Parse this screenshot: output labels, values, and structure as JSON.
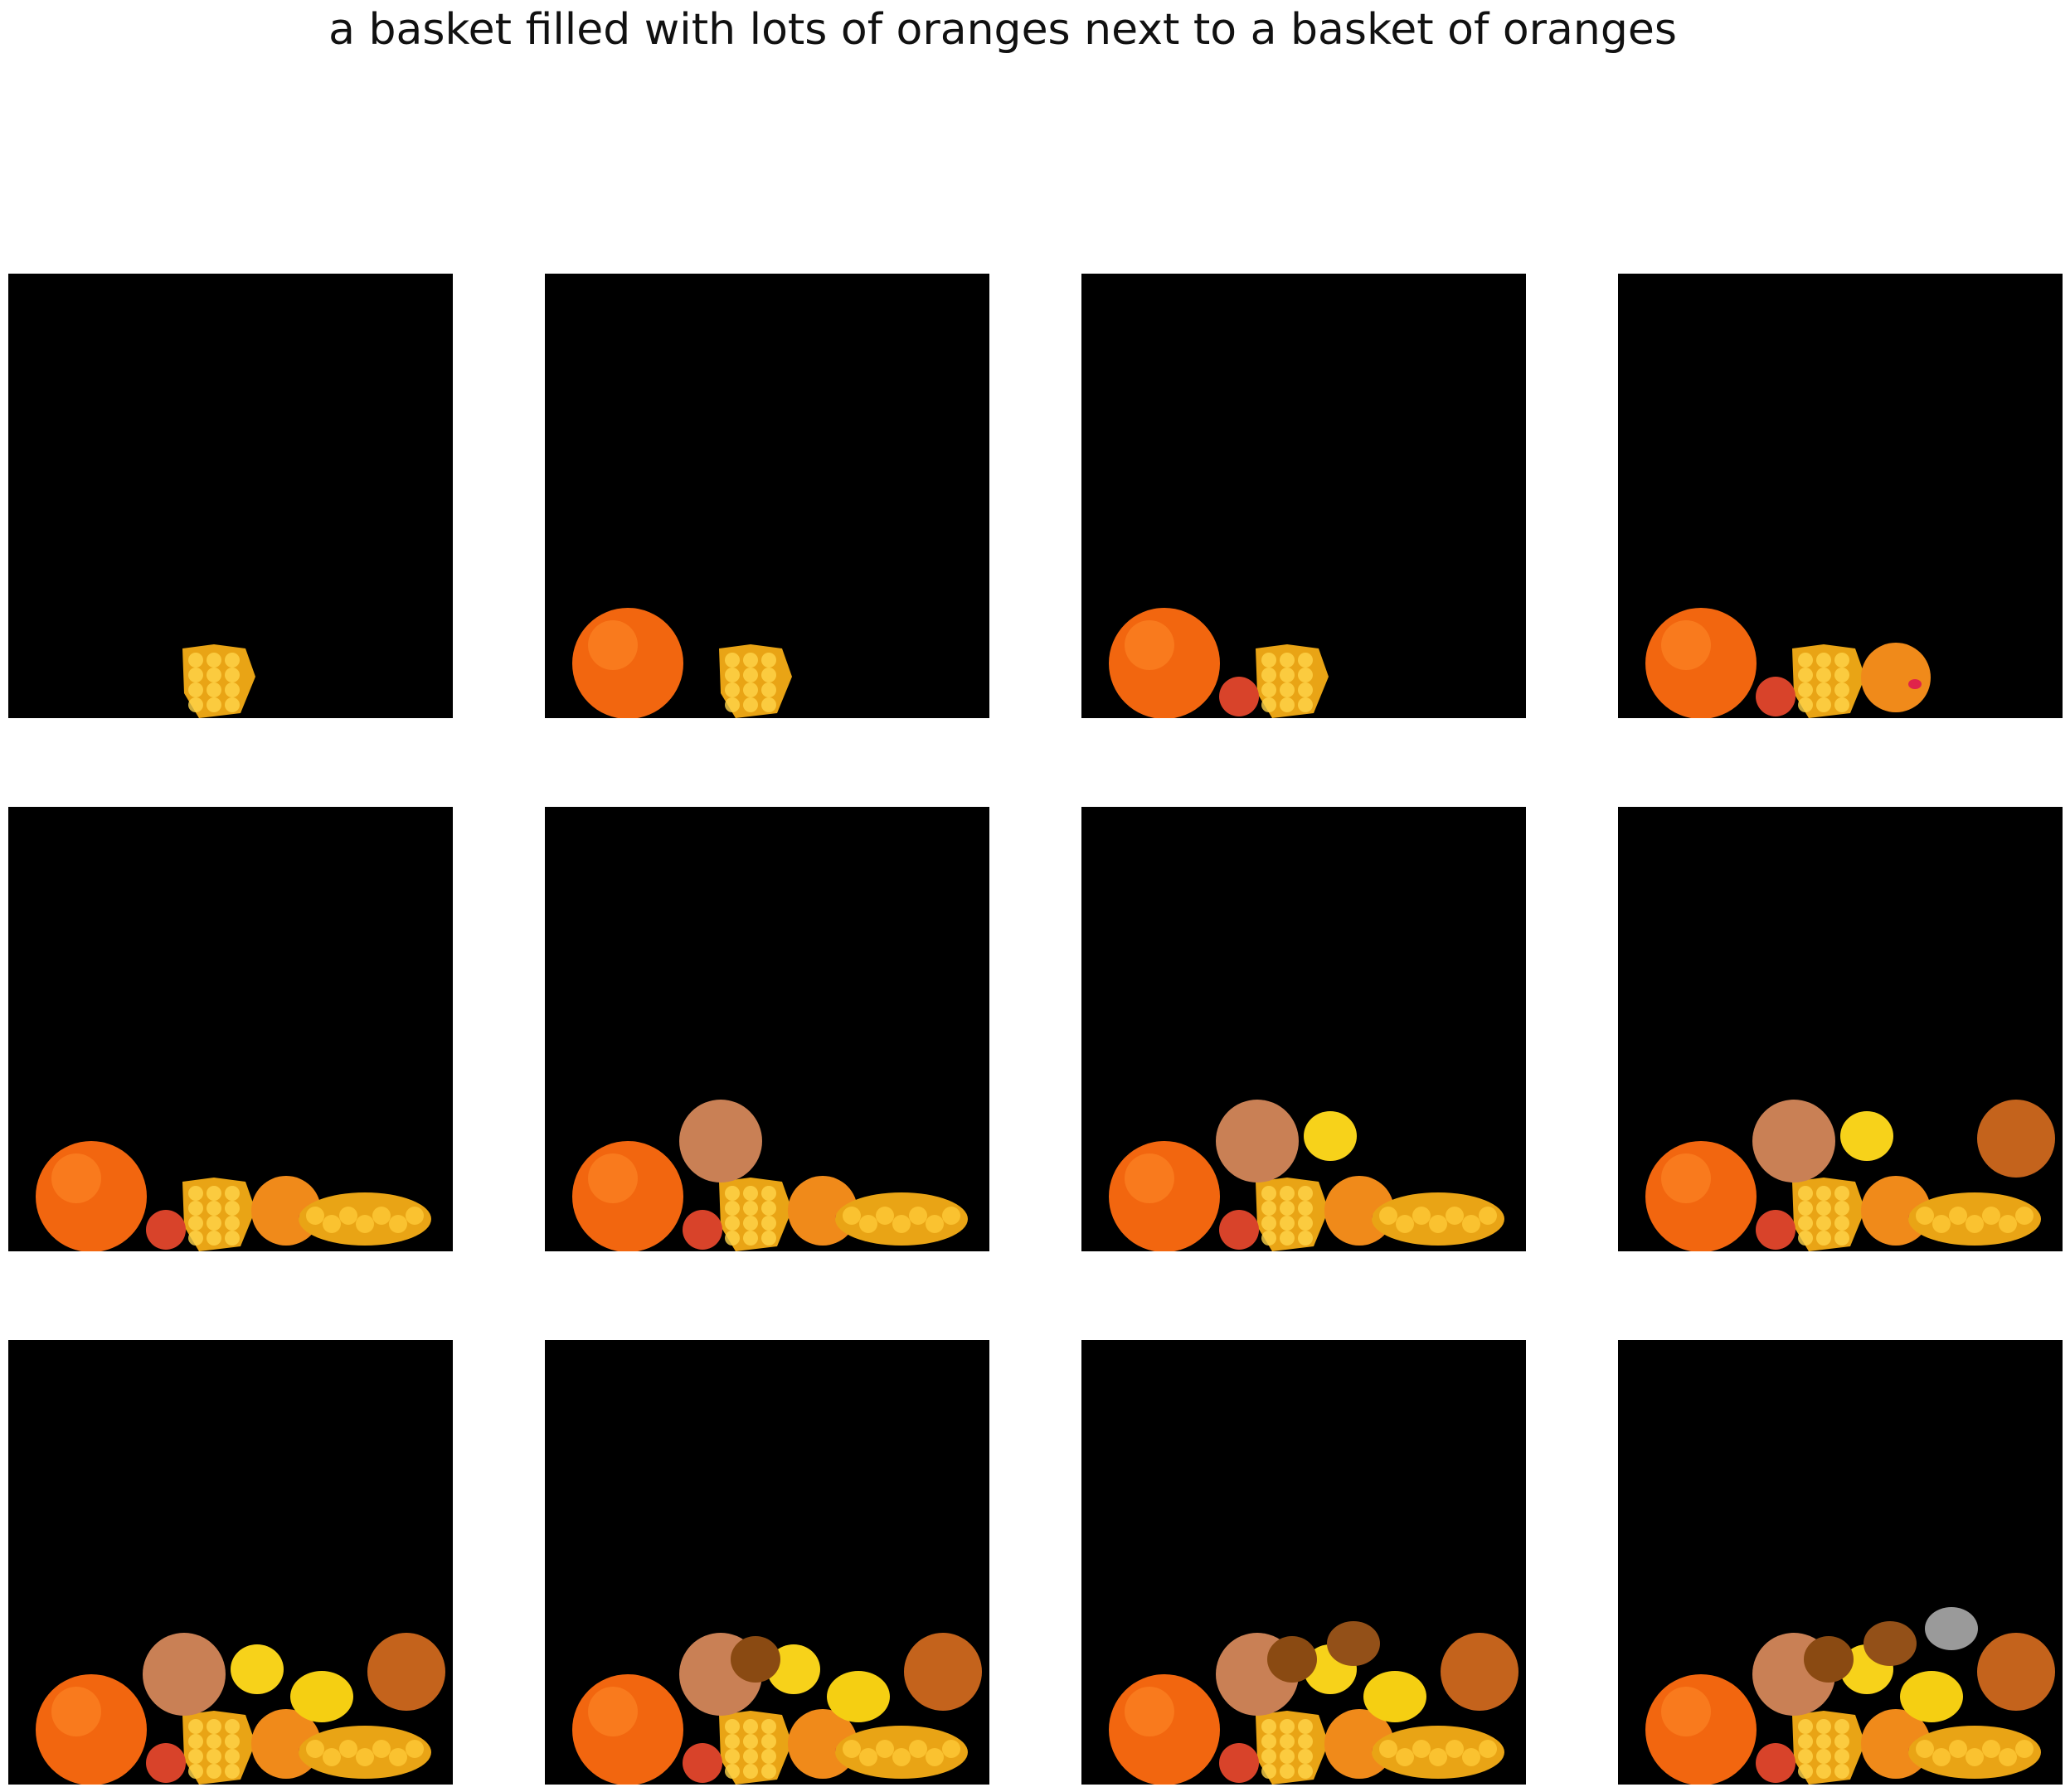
{
  "figure": {
    "caption": "a basket filled with lots of oranges next to a basket of oranges"
  },
  "panels": [
    {
      "step": 1,
      "objects": [
        "basket"
      ]
    },
    {
      "step": 2,
      "objects": [
        "basket",
        "orange-large"
      ]
    },
    {
      "step": 3,
      "objects": [
        "basket",
        "orange-large",
        "red-apple"
      ]
    },
    {
      "step": 4,
      "objects": [
        "basket",
        "orange-large",
        "red-apple",
        "orange-face"
      ]
    },
    {
      "step": 5,
      "objects": [
        "basket",
        "orange-large",
        "red-apple",
        "orange-face",
        "orange-cluster"
      ]
    },
    {
      "step": 6,
      "objects": [
        "basket",
        "orange-large",
        "red-apple",
        "orange-face",
        "orange-cluster",
        "grapefruit"
      ]
    },
    {
      "step": 7,
      "objects": [
        "basket",
        "orange-large",
        "red-apple",
        "orange-face",
        "orange-cluster",
        "grapefruit",
        "lemon-1"
      ]
    },
    {
      "step": 8,
      "objects": [
        "basket",
        "orange-large",
        "red-apple",
        "orange-face",
        "orange-cluster",
        "grapefruit",
        "lemon-1",
        "orange-dark"
      ]
    },
    {
      "step": 9,
      "objects": [
        "basket",
        "orange-large",
        "red-apple",
        "orange-face",
        "orange-cluster",
        "grapefruit",
        "lemon-1",
        "orange-dark",
        "lemon-2"
      ]
    },
    {
      "step": 10,
      "objects": [
        "basket",
        "orange-large",
        "red-apple",
        "orange-face",
        "orange-cluster",
        "grapefruit",
        "lemon-1",
        "orange-dark",
        "lemon-2",
        "brown-fruit-1"
      ]
    },
    {
      "step": 11,
      "objects": [
        "basket",
        "orange-large",
        "red-apple",
        "orange-face",
        "orange-cluster",
        "grapefruit",
        "lemon-1",
        "orange-dark",
        "lemon-2",
        "brown-fruit-1",
        "brown-fruit-2"
      ]
    },
    {
      "step": 12,
      "objects": [
        "basket",
        "orange-large",
        "red-apple",
        "orange-face",
        "orange-cluster",
        "grapefruit",
        "lemon-1",
        "orange-dark",
        "lemon-2",
        "brown-fruit-1",
        "brown-fruit-2",
        "gray-fruit"
      ]
    }
  ],
  "colors": {
    "canvas": "#000000",
    "orange": "#f2660f",
    "basket": "#e9a415",
    "apple": "#d8432a",
    "face_orange": "#f08a1a",
    "grapefruit": "#c98055",
    "lemon": "#f7d21a",
    "dark_orange": "#c4631c",
    "brown": "#8a4a12",
    "gray": "#9a9a9a"
  }
}
